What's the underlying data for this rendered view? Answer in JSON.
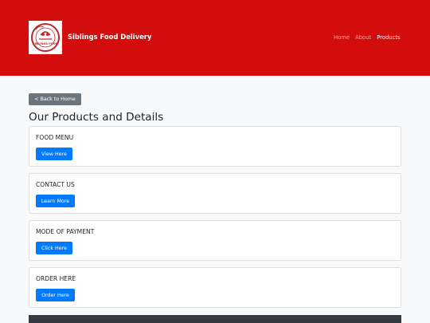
{
  "header": {
    "brand": "Siblings Food Delivery",
    "logo_text": "SIBLINGS FOOD",
    "nav": [
      "Home",
      "About",
      "Products"
    ],
    "active_nav": "Products",
    "background": "#d30c0c"
  },
  "back_button": "< Back to Home",
  "page_title": "Our Products and Details",
  "cards": [
    {
      "title": "FOOD MENU",
      "button": "View Here"
    },
    {
      "title": "CONTACT US",
      "button": "Learn More"
    },
    {
      "title": "MODE OF PAYMENT",
      "button": "Click Here"
    },
    {
      "title": "ORDER HERE",
      "button": "Order Here"
    }
  ],
  "colors": {
    "primary": "#007bff",
    "secondary": "#6c757d",
    "footer": "#343a40",
    "page_bg": "#f8f9fa"
  }
}
